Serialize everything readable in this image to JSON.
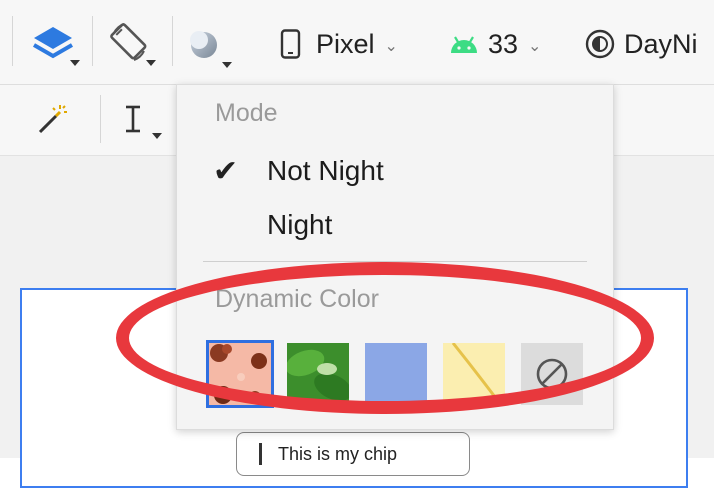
{
  "toolbar": {
    "device_label": "Pixel",
    "api_label": "33",
    "theme_label": "DayNi"
  },
  "menu": {
    "mode_header": "Mode",
    "items": [
      {
        "label": "Not Night",
        "checked": true
      },
      {
        "label": "Night",
        "checked": false
      }
    ],
    "dynamic_header": "Dynamic Color",
    "swatches": [
      {
        "name": "wallpaper-coral-flowers",
        "selected": true
      },
      {
        "name": "wallpaper-green-leaves",
        "selected": false
      },
      {
        "name": "wallpaper-blue",
        "selected": false
      },
      {
        "name": "wallpaper-yellow",
        "selected": false
      },
      {
        "name": "no-dynamic-color",
        "selected": false
      }
    ]
  },
  "preview": {
    "chip_text": "This is my chip"
  },
  "colors": {
    "selection_blue": "#3d7ef0",
    "annotation_red": "#e8383d",
    "android_green": "#3ddc84"
  }
}
